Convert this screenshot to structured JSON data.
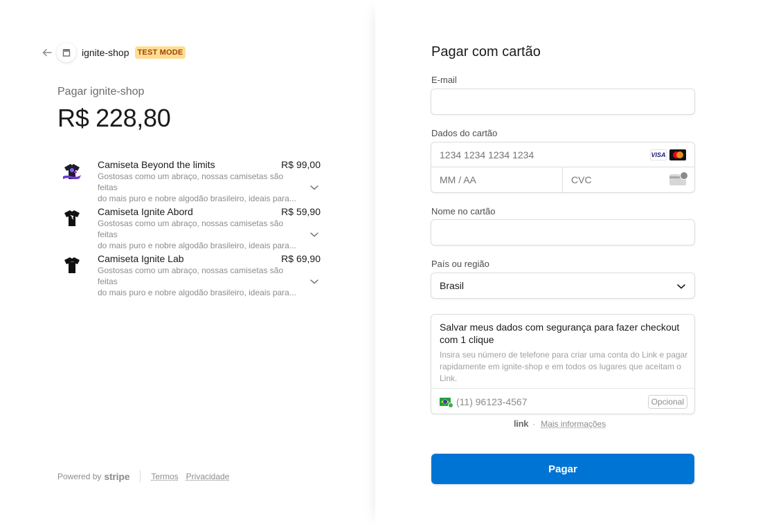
{
  "header": {
    "store_name": "ignite-shop",
    "test_badge": "TEST MODE",
    "back_icon": "arrow-left-icon",
    "store_icon": "store-icon"
  },
  "summary": {
    "pay_label": "Pagar ignite-shop",
    "total": "R$ 228,80"
  },
  "items": [
    {
      "name": "Camiseta Beyond the limits",
      "price": "R$ 99,00",
      "desc_line1": "Gostosas como um abraço, nossas camisetas são feitas",
      "desc_line2": "do mais puro e nobre algodão brasileiro, ideais para..."
    },
    {
      "name": "Camiseta Ignite Abord",
      "price": "R$ 59,90",
      "desc_line1": "Gostosas como um abraço, nossas camisetas são feitas",
      "desc_line2": "do mais puro e nobre algodão brasileiro, ideais para..."
    },
    {
      "name": "Camiseta Ignite Lab",
      "price": "R$ 69,90",
      "desc_line1": "Gostosas como um abraço, nossas camisetas são feitas",
      "desc_line2": "do mais puro e nobre algodão brasileiro, ideais para..."
    }
  ],
  "footer": {
    "powered_by": "Powered by",
    "stripe": "stripe",
    "terms": "Termos",
    "privacy": "Privacidade"
  },
  "form": {
    "title": "Pagar com cartão",
    "email_label": "E-mail",
    "email_value": "",
    "card_label": "Dados do cartão",
    "card_number_placeholder": "1234 1234 1234 1234",
    "expiry_placeholder": "MM / AA",
    "cvc_placeholder": "CVC",
    "visa_label": "VISA",
    "name_label": "Nome no cartão",
    "name_value": "",
    "country_label": "País ou região",
    "country_value": "Brasil"
  },
  "link": {
    "title": "Salvar meus dados com segurança para fazer checkout com 1 clique",
    "description": "Insira seu número de telefone para criar uma conta do Link e pagar rapidamente em ignite-shop e em todos os lugares que aceitam o Link.",
    "phone_placeholder": "(11) 96123-4567",
    "optional": "Opcional",
    "logo": "link",
    "separator": "·",
    "more_info": "Mais informações"
  },
  "pay_button": "Pagar",
  "colors": {
    "accent": "#0074d4",
    "test_badge_bg": "#ffde92",
    "test_badge_text": "#a1410d"
  }
}
